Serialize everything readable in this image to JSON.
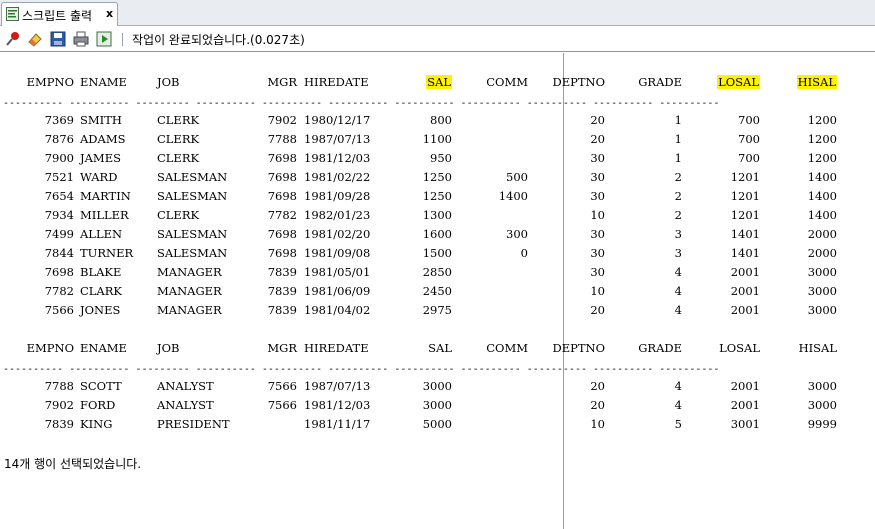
{
  "tab": {
    "title": "스크립트 출력",
    "close": "x"
  },
  "toolbar": {
    "status": "작업이 완료되었습니다.(0.027초)"
  },
  "columns": [
    "EMPNO",
    "ENAME",
    "JOB",
    "MGR",
    "HIREDATE",
    "SAL",
    "COMM",
    "DEPTNO",
    "GRADE",
    "LOSAL",
    "HISAL"
  ],
  "highlight_color": "#fff200",
  "group1": {
    "rows": [
      [
        "7369",
        "SMITH",
        "CLERK",
        "7902",
        "1980/12/17",
        "800",
        "",
        "20",
        "1",
        "700",
        "1200"
      ],
      [
        "7876",
        "ADAMS",
        "CLERK",
        "7788",
        "1987/07/13",
        "1100",
        "",
        "20",
        "1",
        "700",
        "1200"
      ],
      [
        "7900",
        "JAMES",
        "CLERK",
        "7698",
        "1981/12/03",
        "950",
        "",
        "30",
        "1",
        "700",
        "1200"
      ],
      [
        "7521",
        "WARD",
        "SALESMAN",
        "7698",
        "1981/02/22",
        "1250",
        "500",
        "30",
        "2",
        "1201",
        "1400"
      ],
      [
        "7654",
        "MARTIN",
        "SALESMAN",
        "7698",
        "1981/09/28",
        "1250",
        "1400",
        "30",
        "2",
        "1201",
        "1400"
      ],
      [
        "7934",
        "MILLER",
        "CLERK",
        "7782",
        "1982/01/23",
        "1300",
        "",
        "10",
        "2",
        "1201",
        "1400"
      ],
      [
        "7499",
        "ALLEN",
        "SALESMAN",
        "7698",
        "1981/02/20",
        "1600",
        "300",
        "30",
        "3",
        "1401",
        "2000"
      ],
      [
        "7844",
        "TURNER",
        "SALESMAN",
        "7698",
        "1981/09/08",
        "1500",
        "0",
        "30",
        "3",
        "1401",
        "2000"
      ],
      [
        "7698",
        "BLAKE",
        "MANAGER",
        "7839",
        "1981/05/01",
        "2850",
        "",
        "30",
        "4",
        "2001",
        "3000"
      ],
      [
        "7782",
        "CLARK",
        "MANAGER",
        "7839",
        "1981/06/09",
        "2450",
        "",
        "10",
        "4",
        "2001",
        "3000"
      ],
      [
        "7566",
        "JONES",
        "MANAGER",
        "7839",
        "1981/04/02",
        "2975",
        "",
        "20",
        "4",
        "2001",
        "3000"
      ]
    ]
  },
  "group2": {
    "rows": [
      [
        "7788",
        "SCOTT",
        "ANALYST",
        "7566",
        "1987/07/13",
        "3000",
        "",
        "20",
        "4",
        "2001",
        "3000"
      ],
      [
        "7902",
        "FORD",
        "ANALYST",
        "7566",
        "1981/12/03",
        "3000",
        "",
        "20",
        "4",
        "2001",
        "3000"
      ],
      [
        "7839",
        "KING",
        "PRESIDENT",
        "",
        "1981/11/17",
        "5000",
        "",
        "10",
        "5",
        "3001",
        "9999"
      ]
    ]
  },
  "footer": "14개 행이 선택되었습니다."
}
